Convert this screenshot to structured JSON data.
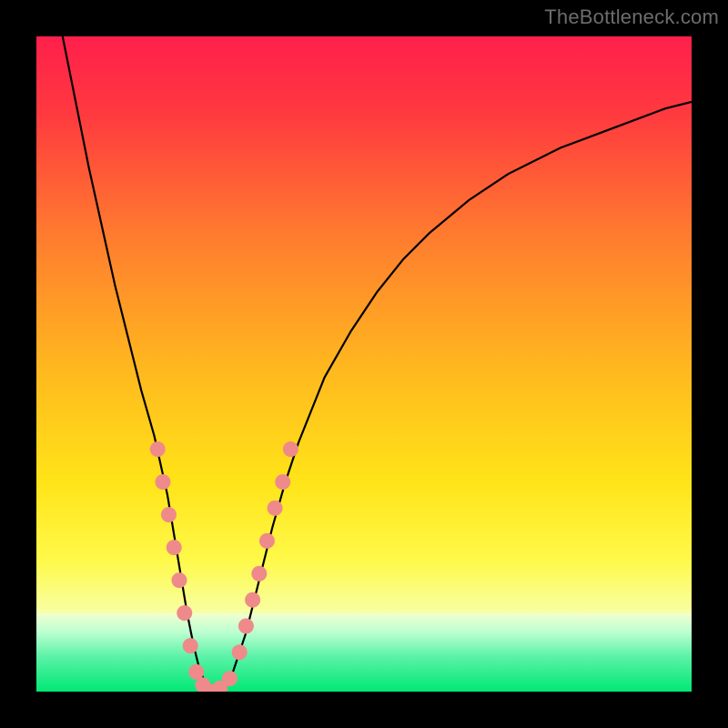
{
  "watermark": "TheBottleneck.com",
  "colors": {
    "frame": "#000000",
    "curve_stroke": "#000000",
    "dot_fill": "#ef8a8a",
    "gradient_stops": [
      {
        "offset": 0.0,
        "color": "#ff1f4b"
      },
      {
        "offset": 0.12,
        "color": "#ff3a3f"
      },
      {
        "offset": 0.3,
        "color": "#ff7a2f"
      },
      {
        "offset": 0.5,
        "color": "#ffb61f"
      },
      {
        "offset": 0.68,
        "color": "#ffe418"
      },
      {
        "offset": 0.8,
        "color": "#fff94a"
      },
      {
        "offset": 0.88,
        "color": "#f7ffa3"
      }
    ],
    "green_band_stops": [
      {
        "offset": 0.0,
        "color": "#f3ffd0"
      },
      {
        "offset": 0.25,
        "color": "#baffd0"
      },
      {
        "offset": 0.55,
        "color": "#5cf2a8"
      },
      {
        "offset": 1.0,
        "color": "#00e874"
      }
    ],
    "green_band_top_pct": 88,
    "green_band_bottom_pct": 100
  },
  "chart_data": {
    "type": "line",
    "title": "",
    "xlabel": "",
    "ylabel": "",
    "xlim": [
      0,
      100
    ],
    "ylim": [
      0,
      100
    ],
    "grid": false,
    "series": [
      {
        "name": "bottleneck-curve",
        "x": [
          4,
          6,
          8,
          10,
          12,
          14,
          16,
          18,
          20,
          21,
          22,
          23,
          24,
          25,
          26,
          27,
          28,
          30,
          32,
          34,
          36,
          38,
          40,
          44,
          48,
          52,
          56,
          60,
          66,
          72,
          80,
          88,
          96,
          100
        ],
        "y": [
          100,
          90,
          80,
          71,
          62,
          54,
          46,
          39,
          30,
          24,
          18,
          12,
          7,
          3,
          1,
          0,
          1,
          3,
          9,
          17,
          25,
          32,
          38,
          48,
          55,
          61,
          66,
          70,
          75,
          79,
          83,
          86,
          89,
          90
        ]
      }
    ],
    "dots": {
      "name": "highlight-dots",
      "points": [
        {
          "x": 18.5,
          "y": 37
        },
        {
          "x": 19.3,
          "y": 32
        },
        {
          "x": 20.2,
          "y": 27
        },
        {
          "x": 21.0,
          "y": 22
        },
        {
          "x": 21.8,
          "y": 17
        },
        {
          "x": 22.6,
          "y": 12
        },
        {
          "x": 23.5,
          "y": 7
        },
        {
          "x": 24.4,
          "y": 3
        },
        {
          "x": 25.4,
          "y": 1
        },
        {
          "x": 26.6,
          "y": 0
        },
        {
          "x": 28.0,
          "y": 0.5
        },
        {
          "x": 29.5,
          "y": 2
        },
        {
          "x": 31.0,
          "y": 6
        },
        {
          "x": 32.0,
          "y": 10
        },
        {
          "x": 33.0,
          "y": 14
        },
        {
          "x": 34.0,
          "y": 18
        },
        {
          "x": 35.2,
          "y": 23
        },
        {
          "x": 36.4,
          "y": 28
        },
        {
          "x": 37.6,
          "y": 32
        },
        {
          "x": 38.8,
          "y": 37
        }
      ]
    }
  }
}
